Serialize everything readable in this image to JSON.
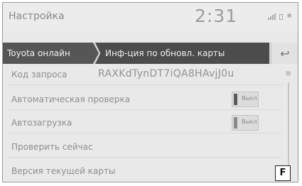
{
  "header": {
    "title": "Настройка",
    "clock": "2:31"
  },
  "breadcrumb": {
    "item1": "Toyota онлайн",
    "item2": "Инф-ция по обновл. карты"
  },
  "rows": {
    "request_code": {
      "label": "Код запроса",
      "value": "RAXKdTynDT7iQA8HAvjJ0u"
    },
    "auto_check": {
      "label": "Автоматическая проверка",
      "toggle": "Выкл"
    },
    "auto_download": {
      "label": "Автозагрузка",
      "toggle": "Выкл"
    },
    "check_now": {
      "label": "Проверить сейчас"
    },
    "map_version": {
      "label": "Версия текущей карты"
    }
  },
  "figure_label": "F"
}
